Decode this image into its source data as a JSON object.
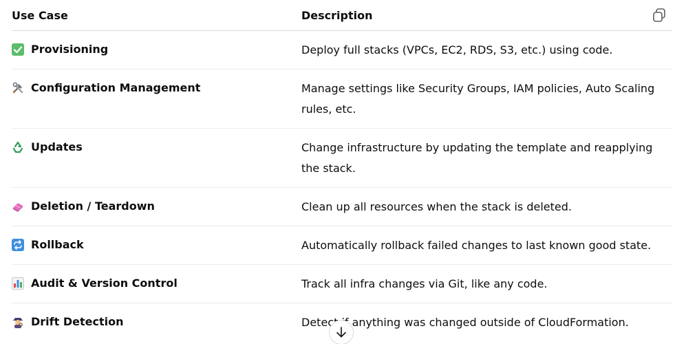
{
  "table": {
    "headers": {
      "use_case": "Use Case",
      "description": "Description"
    },
    "rows": [
      {
        "icon": "check-mark-icon",
        "use_case": "Provisioning",
        "description": "Deploy full stacks (VPCs, EC2, RDS, S3, etc.) using code."
      },
      {
        "icon": "tools-icon",
        "use_case": "Configuration Management",
        "description": "Manage settings like Security Groups, IAM policies, Auto Scaling rules, etc."
      },
      {
        "icon": "recycle-icon",
        "use_case": "Updates",
        "description": "Change infrastructure by updating the template and reapplying the stack."
      },
      {
        "icon": "eraser-icon",
        "use_case": "Deletion / Teardown",
        "description": "Clean up all resources when the stack is deleted."
      },
      {
        "icon": "repeat-icon",
        "use_case": "Rollback",
        "description": "Automatically rollback failed changes to last known good state."
      },
      {
        "icon": "bar-chart-icon",
        "use_case": "Audit & Version Control",
        "description": "Track all infra changes via Git, like any code."
      },
      {
        "icon": "detective-icon",
        "use_case": "Drift Detection",
        "description": "Detect if anything was changed outside of CloudFormation."
      }
    ]
  },
  "controls": {
    "copy_icon": "copy-icon",
    "scroll_icon": "arrow-down-icon"
  }
}
